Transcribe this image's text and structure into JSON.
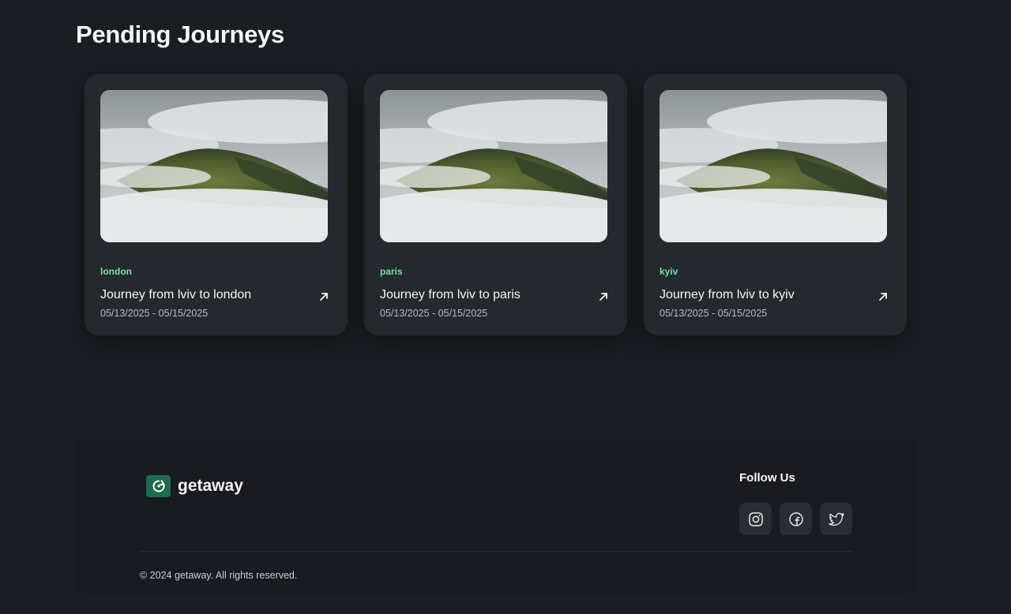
{
  "page": {
    "title": "Pending Journeys"
  },
  "journeys": [
    {
      "tag": "london",
      "title": "Journey from lviv to london",
      "dates": "05/13/2025 - 05/15/2025"
    },
    {
      "tag": "paris",
      "title": "Journey from lviv to paris",
      "dates": "05/13/2025 - 05/15/2025"
    },
    {
      "tag": "kyiv",
      "title": "Journey from lviv to kyiv",
      "dates": "05/13/2025 - 05/15/2025"
    }
  ],
  "footer": {
    "brand": "getaway",
    "follow_title": "Follow Us",
    "socials": [
      "instagram-icon",
      "facebook-icon",
      "twitter-icon"
    ],
    "copyright": "© 2024 getaway. All rights reserved."
  },
  "colors": {
    "background": "#1a1d22",
    "card": "#25282d",
    "tag": "#6fe3a3",
    "brand_logo": "#1f6b4f",
    "social_button": "#2a2d33"
  }
}
